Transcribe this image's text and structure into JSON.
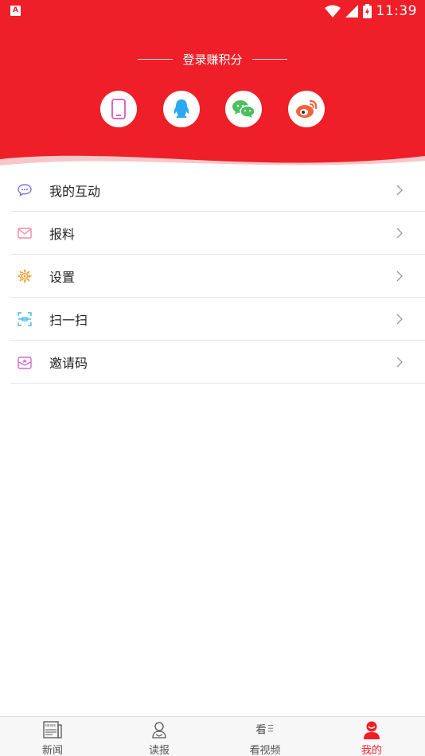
{
  "status_bar": {
    "app_badge": "A",
    "time": "11:39"
  },
  "header": {
    "login_prompt": "登录赚积分",
    "social_buttons": [
      {
        "icon": "phone-icon",
        "color": "#e066c8"
      },
      {
        "icon": "qq-icon",
        "color": "#2aa8f2"
      },
      {
        "icon": "wechat-icon",
        "color": "#4cc05e"
      },
      {
        "icon": "weibo-icon",
        "color": "#f0643a"
      }
    ],
    "background_color": "#ee1f28"
  },
  "menu": {
    "items": [
      {
        "label": "我的互动",
        "icon": "chat-bubble-icon",
        "icon_color": "#7b6fe0"
      },
      {
        "label": "报料",
        "icon": "mail-icon",
        "icon_color": "#f08aa0"
      },
      {
        "label": "设置",
        "icon": "gear-icon",
        "icon_color": "#f39a2d"
      },
      {
        "label": "扫一扫",
        "icon": "scan-icon",
        "icon_color": "#3fb8e6"
      },
      {
        "label": "邀请码",
        "icon": "invite-envelope-icon",
        "icon_color": "#d86ad0"
      }
    ]
  },
  "tabbar": {
    "tabs": [
      {
        "label": "新闻",
        "icon": "newspaper-icon",
        "active": false
      },
      {
        "label": "读报",
        "icon": "reader-icon",
        "active": false
      },
      {
        "label": "看视频",
        "icon": "video-icon",
        "active": false
      },
      {
        "label": "我的",
        "icon": "profile-icon",
        "active": true
      }
    ],
    "active_color": "#ee1f28"
  }
}
